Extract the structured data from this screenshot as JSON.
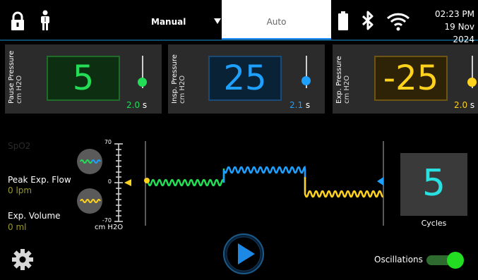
{
  "header": {
    "tabs": [
      {
        "label": "Manual",
        "selected": false
      },
      {
        "label": "Auto",
        "selected": true
      }
    ],
    "time": "02:23 PM",
    "date": "19 Nov 2024",
    "status_icons": [
      "lock-icon",
      "patient-icon",
      "battery-icon",
      "bluetooth-icon",
      "wifi-icon"
    ]
  },
  "panels": [
    {
      "title": "Pause Pressure",
      "unit": "cm H2O",
      "value": "5",
      "time": "2.0",
      "time_unit": "s",
      "color": "#22dd55",
      "bg": "#0d2e10"
    },
    {
      "title": "Insp. Pressure",
      "unit": "cm H2O",
      "value": "25",
      "time": "2.1",
      "time_unit": "s",
      "color": "#1ea0ff",
      "bg": "#0a2236"
    },
    {
      "title": "Exp. Pressure",
      "unit": "cm H2O",
      "value": "-25",
      "time": "2.0",
      "time_unit": "s",
      "color": "#ffd21e",
      "bg": "#2e2306"
    }
  ],
  "side": {
    "spo2_label": "SpO2",
    "peak_flow_label": "Peak Exp. Flow",
    "peak_flow_value": "0 lpm",
    "volume_label": "Exp. Volume",
    "volume_value": "0 ml"
  },
  "scale": {
    "max": "70",
    "zero": "0",
    "min": "-70",
    "unit": "cm H2O"
  },
  "cycles": {
    "value": "5",
    "label": "Cycles",
    "color": "#28e0e0"
  },
  "bottom": {
    "oscillations_label": "Oscillations",
    "oscillations_on": true
  }
}
